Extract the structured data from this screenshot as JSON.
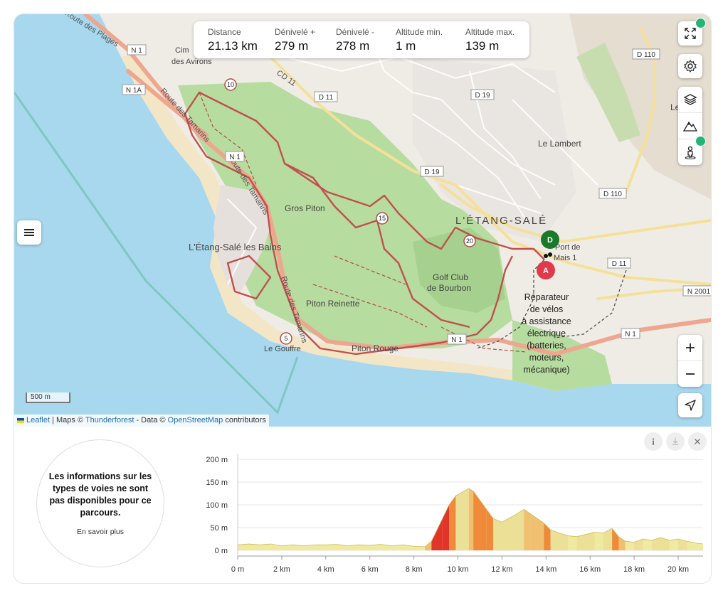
{
  "stats": [
    {
      "label": "Distance",
      "value": "21.13 km"
    },
    {
      "label": "Dénivelé +",
      "value": "279 m"
    },
    {
      "label": "Dénivelé -",
      "value": "278 m"
    },
    {
      "label": "Altitude min.",
      "value": "1 m"
    },
    {
      "label": "Altitude max.",
      "value": "139 m"
    }
  ],
  "map": {
    "places": {
      "gros_piton": "Gros Piton",
      "etang_sale_bains": "L'Étang-Salé les Bains",
      "etang_sale": "L'ÉTANG-SALÉ",
      "golf_1": "Golf Club",
      "golf_2": "de Bourbon",
      "piton_reinette": "Piton Reinette",
      "piton_rouge": "Piton Rouge",
      "le_gouffre": "Le Gouffre",
      "le_lambert": "Le Lambert",
      "cimetiere_1": "Cim",
      "cimetiere_2": "des Avirons",
      "port_1": "Port de",
      "port_2": "Mais 1",
      "le_bras": "Le Brin"
    },
    "roads": {
      "route_tamarins_1": "Route des Tamarins",
      "route_tamarins_2": "Route des Tamarins",
      "route_tamarins_3": "Route des Tamarins",
      "route_plages": "Route des Plages",
      "cd11": "CD 11"
    },
    "shields": [
      "N 1",
      "N 1A",
      "N 1",
      "D 11",
      "D 19",
      "D 19",
      "D 110",
      "D 110",
      "D 11",
      "N 2001",
      "N 1",
      "N 1"
    ],
    "km_markers": [
      "10",
      "15",
      "20",
      "5"
    ],
    "start_marker": "A",
    "end_marker": "D",
    "poi_lines": [
      "Réparateur",
      "de vélos",
      "à assistance",
      "électrique",
      "(batteries,",
      "moteurs,",
      "mécanique)"
    ],
    "scale": "500 m",
    "attribution": {
      "leaflet": "Leaflet",
      "sep1": " | Maps © ",
      "thunderforest": "Thunderforest",
      "sep2": " - Data © ",
      "osm": "OpenStreetMap",
      "tail": " contributors"
    },
    "controls": [
      "fullscreen-icon",
      "gear-icon",
      "layers-icon",
      "mountain-icon",
      "pegman-icon",
      "plus-icon",
      "minus-icon",
      "locate-icon",
      "menu-icon"
    ],
    "colors": {
      "route": "#c0504d",
      "start": "#e03a4a",
      "end": "#1a7a2a",
      "sea": "#a8d8ee",
      "green": "#b7dca0"
    }
  },
  "info": {
    "message": "Les informations sur les types de voies ne sont pas disponibles pour ce parcours.",
    "more": "En savoir plus"
  },
  "chart_buttons": [
    "info-icon",
    "download-icon",
    "close-icon"
  ],
  "chart_data": {
    "type": "area",
    "title": "",
    "xlabel": "",
    "ylabel": "",
    "x_ticks": [
      "0 m",
      "2 km",
      "4 km",
      "6 km",
      "8 km",
      "10 km",
      "12 km",
      "14 km",
      "16 km",
      "18 km",
      "20 km"
    ],
    "y_ticks": [
      "0 m",
      "50 m",
      "100 m",
      "150 m",
      "200 m"
    ],
    "xlim": [
      0,
      21.13
    ],
    "ylim": [
      0,
      200
    ],
    "x": [
      0,
      0.5,
      1,
      1.5,
      2,
      2.5,
      3,
      3.5,
      4,
      4.5,
      5,
      5.5,
      6,
      6.5,
      7,
      7.5,
      8,
      8.5,
      8.8,
      9,
      9.3,
      9.6,
      9.9,
      10.2,
      10.5,
      10.7,
      11,
      11.3,
      11.6,
      12,
      12.3,
      12.6,
      13,
      13.3,
      13.6,
      13.9,
      14.2,
      14.6,
      15,
      15.4,
      15.8,
      16.2,
      16.6,
      17,
      17.3,
      17.6,
      18,
      18.4,
      18.8,
      19.2,
      19.6,
      20,
      20.4,
      20.8,
      21.13
    ],
    "y": [
      12,
      14,
      12,
      14,
      10,
      12,
      10,
      12,
      12,
      13,
      10,
      12,
      11,
      13,
      10,
      12,
      9,
      8,
      20,
      40,
      70,
      100,
      120,
      128,
      136,
      130,
      110,
      90,
      70,
      62,
      70,
      78,
      90,
      80,
      70,
      60,
      45,
      38,
      32,
      30,
      35,
      40,
      38,
      48,
      30,
      20,
      18,
      25,
      22,
      28,
      22,
      25,
      20,
      16,
      14
    ],
    "intensity_colors": {
      "low": "#ecdf96",
      "mid": "#f0c070",
      "high": "#ef8a3a",
      "steep": "#e2352a",
      "base": "#f0eaa0"
    }
  }
}
